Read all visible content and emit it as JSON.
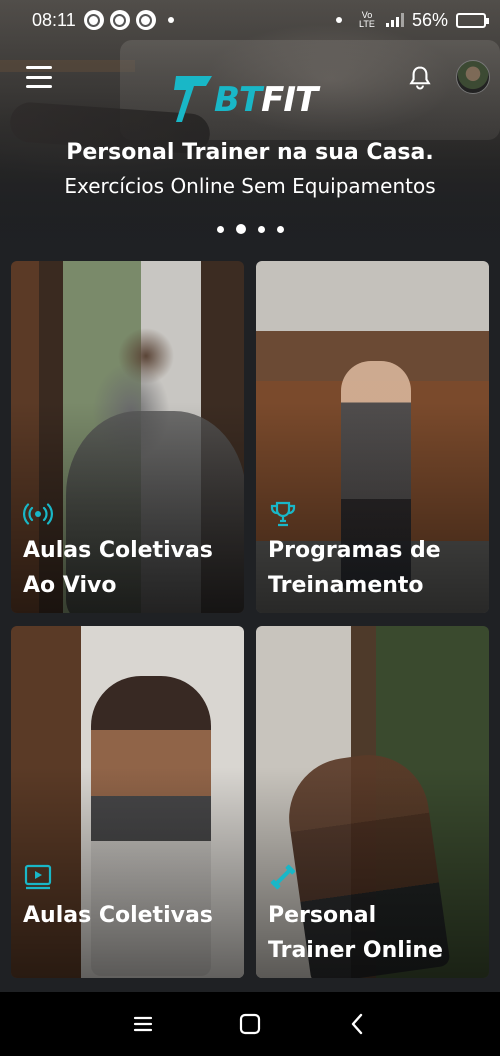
{
  "status_bar": {
    "time": "08:11",
    "notification_icons": [
      "whatsapp-icon",
      "whatsapp-icon",
      "whatsapp-icon"
    ],
    "network": "Vo LTE",
    "battery": "56%",
    "battery_level": 0.56
  },
  "app_bar": {
    "logo_bt": "BT",
    "logo_fit": "FIT"
  },
  "hero": {
    "title": "Personal Trainer na sua Casa.",
    "subtitle": "Exercícios Online Sem Equipamentos",
    "slide_count": 4,
    "active_slide": 2
  },
  "cards": [
    {
      "icon": "live-broadcast-icon",
      "line1": "Aulas Coletivas",
      "line2": "Ao Vivo"
    },
    {
      "icon": "trophy-icon",
      "line1": "Programas de",
      "line2": "Treinamento"
    },
    {
      "icon": "video-player-icon",
      "line1": "Aulas Coletivas",
      "line2": ""
    },
    {
      "icon": "dumbbell-icon",
      "line1": "Personal",
      "line2": "Trainer Online"
    }
  ],
  "colors": {
    "accent": "#19b7c7",
    "background": "#1f2124",
    "battery": "#4cd137"
  }
}
